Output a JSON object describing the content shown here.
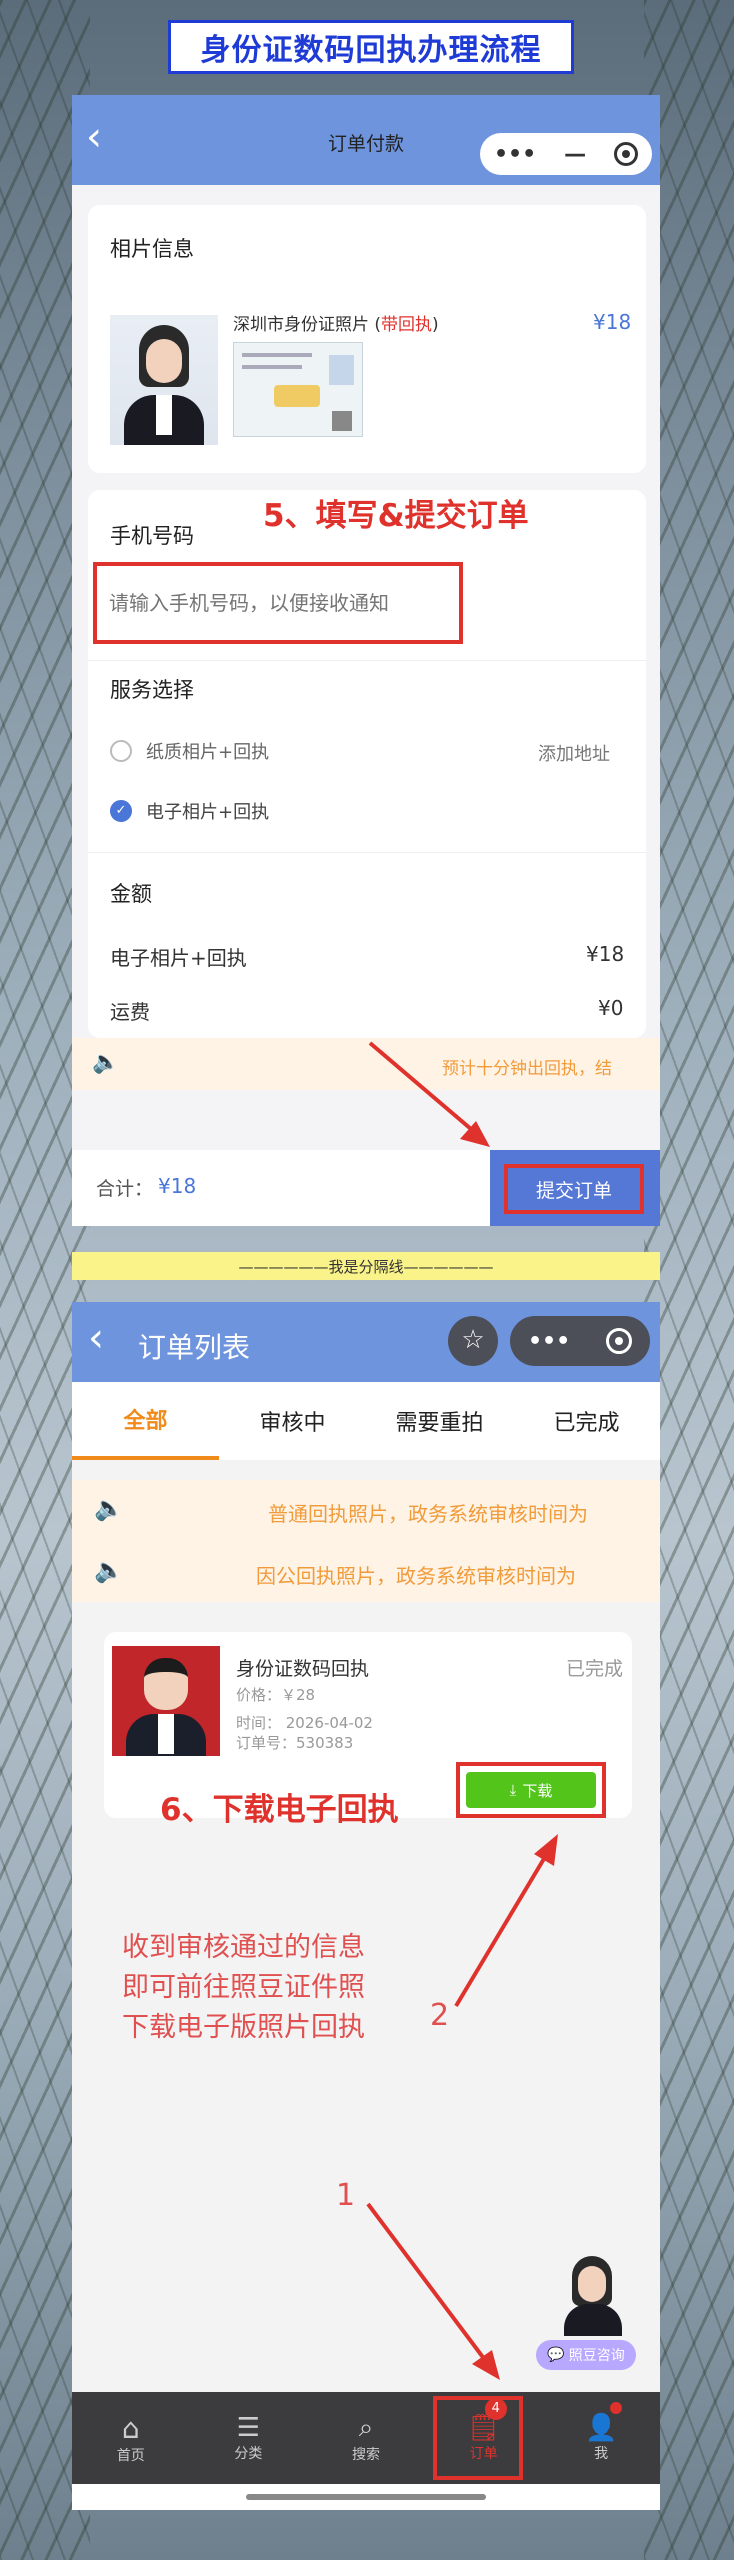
{
  "banner": {
    "title": "身份证数码回执办理流程"
  },
  "screen1": {
    "nav_title": "订单付款",
    "capsule_more": "•••",
    "capsule_min": "—",
    "photo_section": {
      "title": "相片信息",
      "product_name": "深圳市身份证照片 (",
      "product_tag": "带回执",
      "product_close": ")",
      "price": "¥18"
    },
    "phone_section": {
      "title": "手机号码",
      "placeholder": "请输入手机号码，以便接收通知"
    },
    "step5_label": "5、填写&提交订单",
    "service": {
      "title": "服务选择",
      "options": [
        {
          "label": "纸质相片+回执",
          "selected": false,
          "extra": "添加地址"
        },
        {
          "label": "电子相片+回执",
          "selected": true,
          "extra": ""
        }
      ]
    },
    "amount": {
      "title": "金额",
      "rows": [
        {
          "label": "电子相片+回执",
          "value": "¥18"
        },
        {
          "label": "运费",
          "value": "¥0"
        }
      ]
    },
    "notice": "预计十分钟出回执，结",
    "footer": {
      "total_label": "合计：",
      "total_value": "¥18",
      "submit": "提交订单"
    }
  },
  "divider": "——————我是分隔线——————",
  "screen2": {
    "nav_title": "订单列表",
    "tabs": [
      "全部",
      "审核中",
      "需要重拍",
      "已完成"
    ],
    "notices": [
      "普通回执照片，政务系统审核时间为",
      "因公回执照片，政务系统审核时间为"
    ],
    "order": {
      "title": "身份证数码回执",
      "status": "已完成",
      "price": "价格：￥28",
      "time": "时间：  2026-04-02",
      "order_no": "订单号：530383",
      "download": "下载"
    },
    "step6_label": "6、下载电子回执",
    "annotation": [
      "收到审核通过的信息",
      "即可前往照豆证件照",
      "下载电子版照片回执"
    ],
    "arrow_num_2": "2",
    "arrow_num_1": "1",
    "consult": "照豆咨询",
    "tabbar": [
      {
        "label": "首页",
        "icon": "home-icon"
      },
      {
        "label": "分类",
        "icon": "category-icon"
      },
      {
        "label": "搜索",
        "icon": "search-icon"
      },
      {
        "label": "订单",
        "icon": "order-icon",
        "badge": "4"
      },
      {
        "label": "我",
        "icon": "user-icon"
      }
    ]
  },
  "colors": {
    "accent_blue": "#6f94de",
    "annotation_red": "#e0322c",
    "tab_orange": "#f08a1b",
    "download_green": "#52c41a"
  }
}
